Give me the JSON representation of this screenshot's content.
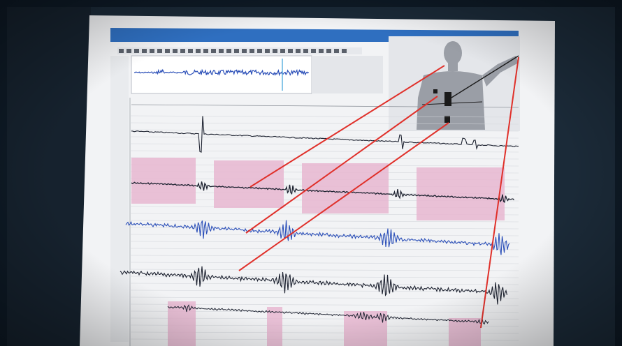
{
  "scene": {
    "description_kind": "photo of a monitor displaying a physiological signal analysis software screen",
    "colors": {
      "room": "#0e1a26",
      "bezel": "#1b2a38",
      "screen_paper": "#f2f3f5",
      "title_bar": "#2f6fc0",
      "panel_gray": "#e4e6ea",
      "trace_blue": "#2b4fb8",
      "trace_dark": "#1d2230",
      "event_pink": "#e8b6d0",
      "annotation_red": "#e0302a",
      "grid_line": "#c9ccd2",
      "body_figure": "#9a9ea6"
    },
    "icons": [
      "toolbar-icon",
      "body-figure-icon",
      "sensor-marker-icon"
    ]
  }
}
